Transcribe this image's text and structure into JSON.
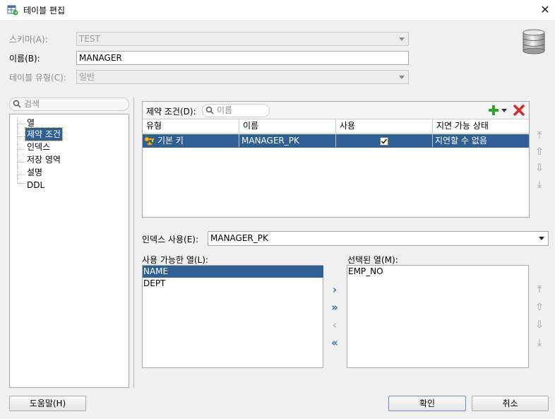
{
  "window": {
    "title": "테이블 편집",
    "close_glyph": "✕"
  },
  "form": {
    "schema_label": "스키마(A):",
    "schema_value": "TEST",
    "name_label": "이름(B):",
    "name_value": "MANAGER",
    "type_label": "테이블 유형(C):",
    "type_value": "일반"
  },
  "nav": {
    "search_placeholder": "검색",
    "items": [
      "열",
      "제약 조건",
      "인덱스",
      "저장 영역",
      "설명",
      "DDL"
    ],
    "selected_index": 1
  },
  "constraints": {
    "label": "제약 조건(D):",
    "search_placeholder": "이름",
    "columns": [
      "유형",
      "이름",
      "사용",
      "지연 가능 상태"
    ],
    "rows": [
      {
        "type": "기본 키",
        "name": "MANAGER_PK",
        "enabled": true,
        "deferrable": "지연할 수 없음"
      }
    ]
  },
  "index": {
    "label": "인덱스 사용(E):",
    "value": "MANAGER_PK"
  },
  "available": {
    "label": "사용 가능한 열(L):",
    "items": [
      "NAME",
      "DEPT"
    ],
    "selected_index": 0
  },
  "selected": {
    "label": "선택된 열(M):",
    "items": [
      "EMP_NO"
    ]
  },
  "buttons": {
    "help": "도움말(H)",
    "ok": "확인",
    "cancel": "취소"
  },
  "colors": {
    "selection": "#2f5f94",
    "add_green": "#2aa52a",
    "delete_red": "#d42a2a",
    "mover_blue": "#2f6fbf"
  }
}
